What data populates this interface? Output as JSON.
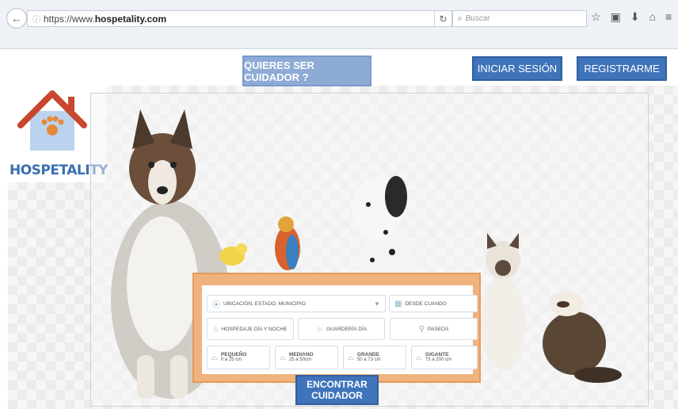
{
  "browser": {
    "url_prefix": "https://www.",
    "url_host": "hospetality.com",
    "search_placeholder": "Buscar"
  },
  "header": {
    "cuidador_button": "QUIERES SER CUIDADOR ?",
    "login_button": "INICIAR SESIÓN",
    "register_button": "REGISTRARME"
  },
  "logo": {
    "wordmark": "HOSPETALITY"
  },
  "search": {
    "location_placeholder": "UBICACIÓN, ESTADO, MUNICIPIO",
    "date_placeholder": "DESDE CUANDO",
    "services": [
      {
        "label": "HOSPEDAJE DÍA Y NOCHE"
      },
      {
        "label": "GUARDERÍA DÍA"
      },
      {
        "label": "PASEOS"
      }
    ],
    "sizes": [
      {
        "label": "PEQUEÑO",
        "range": "0 a 25 cm"
      },
      {
        "label": "MEDIANO",
        "range": "25 a 50cm"
      },
      {
        "label": "GRANDE",
        "range": "50 a 73 cm"
      },
      {
        "label": "GIGANTE",
        "range": "73 a 200 cm"
      }
    ],
    "submit_line1": "ENCONTRAR",
    "submit_line2": "CUIDADOR"
  },
  "colors": {
    "primary": "#3f74bb",
    "panel": "#f0b27f",
    "logo_roof": "#c8472e"
  }
}
